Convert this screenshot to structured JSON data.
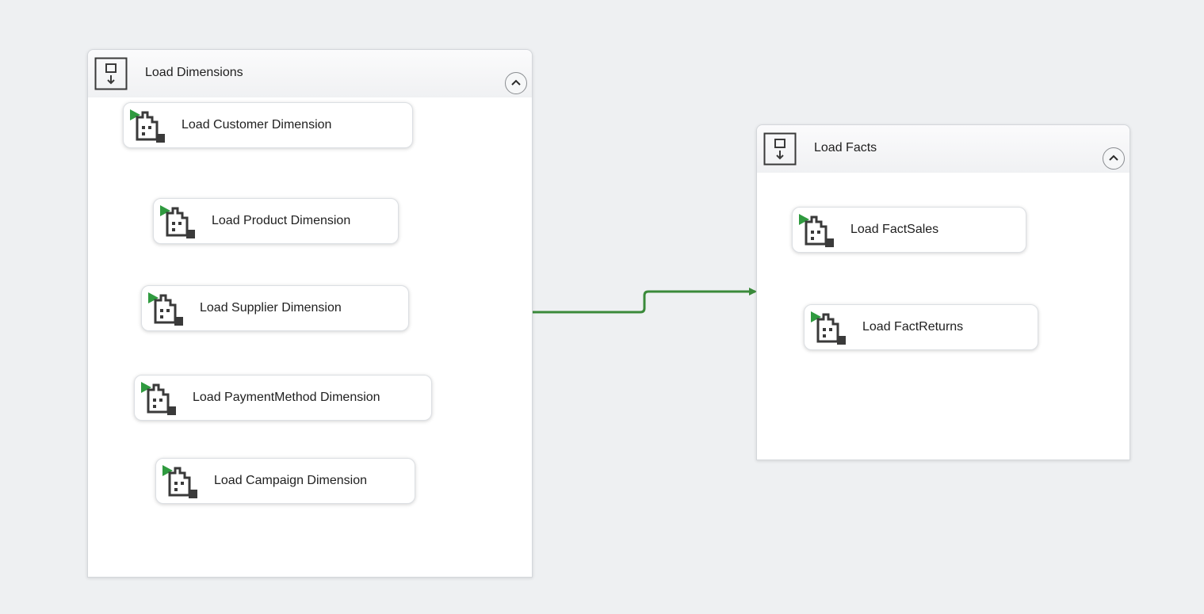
{
  "colors": {
    "background": "#eef0f2",
    "precedence_arrow": "#3a8a3a",
    "task_icon_green": "#2f9a3f",
    "icon_dark": "#3a3a3a"
  },
  "containers": [
    {
      "title": "Load Dimensions",
      "icon": "sequence-container-icon",
      "collapse_icon": "chevron-up-icon",
      "tasks": [
        {
          "label": "Load Customer Dimension",
          "icon": "data-flow-task-icon"
        },
        {
          "label": "Load Product Dimension",
          "icon": "data-flow-task-icon"
        },
        {
          "label": "Load Supplier Dimension",
          "icon": "data-flow-task-icon"
        },
        {
          "label": "Load PaymentMethod Dimension",
          "icon": "data-flow-task-icon"
        },
        {
          "label": "Load Campaign Dimension",
          "icon": "data-flow-task-icon"
        }
      ]
    },
    {
      "title": "Load Facts",
      "icon": "sequence-container-icon",
      "collapse_icon": "chevron-up-icon",
      "tasks": [
        {
          "label": "Load FactSales",
          "icon": "data-flow-task-icon"
        },
        {
          "label": "Load FactReturns",
          "icon": "data-flow-task-icon"
        }
      ]
    }
  ]
}
